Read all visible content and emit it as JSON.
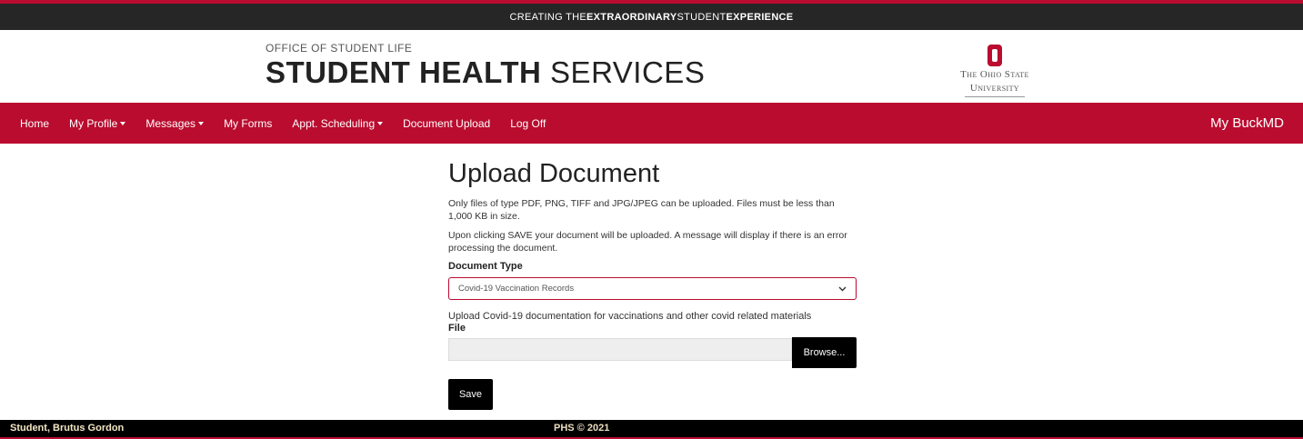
{
  "topbar": {
    "prefix": "CREATING THE ",
    "bold1": "EXTRAORDINARY",
    "middle": " STUDENT ",
    "bold2": "EXPERIENCE"
  },
  "brand": {
    "office": "OFFICE OF STUDENT LIFE",
    "title_bold": "STUDENT HEALTH",
    "title_light": " SERVICES"
  },
  "logo": {
    "line1": "The Ohio State",
    "line2": "University",
    "icon": "block-o-icon"
  },
  "nav": {
    "items": [
      {
        "label": "Home",
        "dropdown": false
      },
      {
        "label": "My Profile",
        "dropdown": true
      },
      {
        "label": "Messages",
        "dropdown": true
      },
      {
        "label": "My Forms",
        "dropdown": false
      },
      {
        "label": "Appt. Scheduling",
        "dropdown": true
      },
      {
        "label": "Document Upload",
        "dropdown": false
      },
      {
        "label": "Log Off",
        "dropdown": false
      }
    ],
    "right": "My BuckMD"
  },
  "main": {
    "title": "Upload Document",
    "info1": "Only files of type PDF, PNG, TIFF and JPG/JPEG can be uploaded. Files must be less than 1,000 KB in size.",
    "info2": "Upon clicking SAVE your document will be uploaded. A message will display if there is an error processing the document.",
    "doc_type_label": "Document Type",
    "doc_type_selected": "Covid-19 Vaccination Records",
    "help": "Upload Covid-19 documentation for vaccinations and other covid related materials",
    "file_label": "File",
    "file_value": "",
    "browse_label": "Browse...",
    "save_label": "Save"
  },
  "footer": {
    "user": "Student, Brutus Gordon",
    "copyright": "PHS © 2021"
  },
  "colors": {
    "scarlet": "#ba0c2f",
    "dark": "#262626",
    "black": "#000000"
  }
}
